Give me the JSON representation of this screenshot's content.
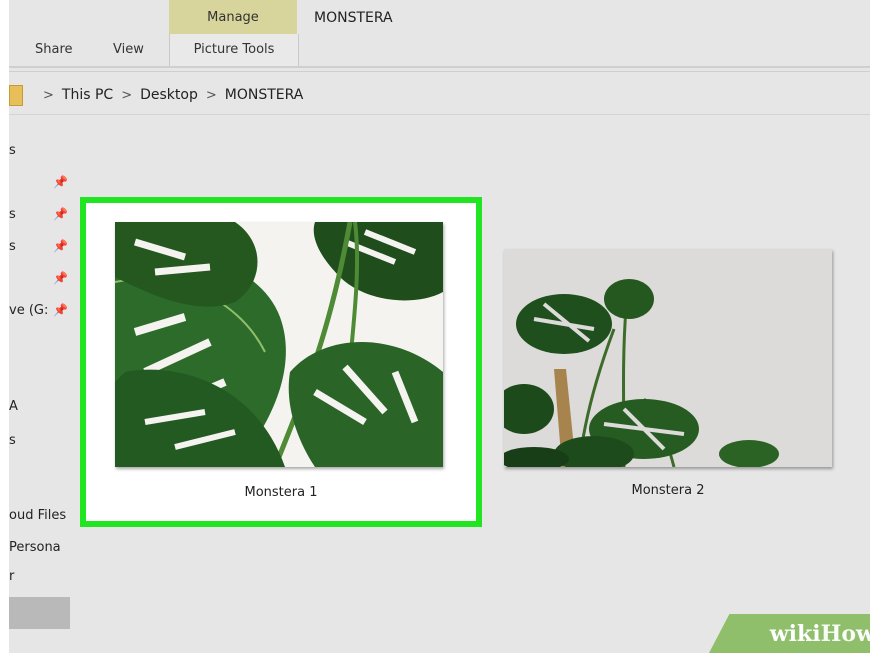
{
  "window": {
    "title": "MONSTERA"
  },
  "ribbon": {
    "context_tab": "Manage",
    "tabs": [
      "Share",
      "View",
      "Picture Tools"
    ]
  },
  "address": {
    "crumbs": [
      "This PC",
      "Desktop",
      "MONSTERA"
    ],
    "separator": ">"
  },
  "nav": {
    "items": [
      "s",
      "",
      "s",
      "s",
      "",
      "ve (G:",
      "",
      "A",
      "s",
      "oud Files",
      "Persona",
      "r"
    ],
    "pin_icon": "pin-icon"
  },
  "files": [
    {
      "name": "Monstera 1",
      "selected": true
    },
    {
      "name": "Monstera 2",
      "selected": false
    }
  ],
  "colors": {
    "selection_highlight": "#22e522",
    "ribbon_context": "#d7d59b"
  },
  "watermark": {
    "part1": "wiki",
    "part2": "How"
  }
}
